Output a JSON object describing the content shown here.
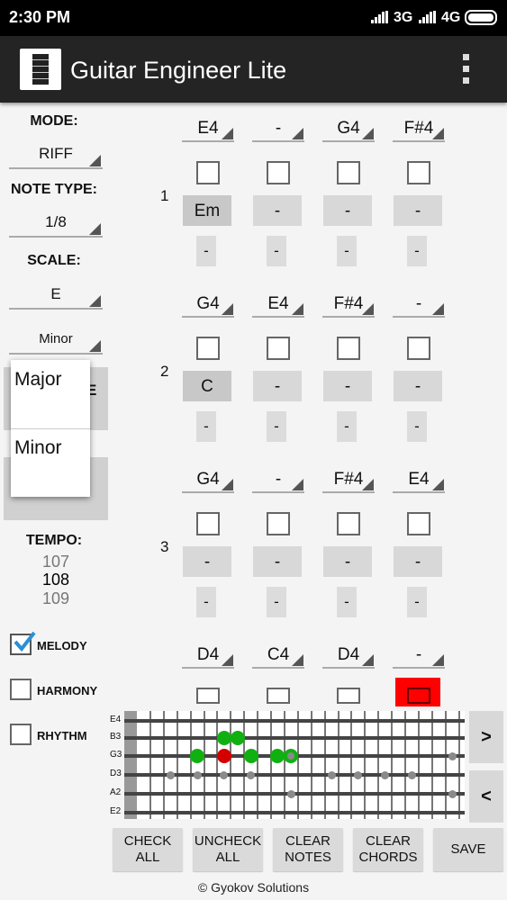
{
  "status": {
    "time": "2:30 PM",
    "net1": "3G",
    "net2": "4G"
  },
  "app": {
    "title": "Guitar Engineer Lite",
    "icons": {
      "app": "guitar-neck-icon",
      "menu": "overflow-menu-icon"
    }
  },
  "sidebar": {
    "mode_label": "MODE:",
    "mode_value": "RIFF",
    "note_type_label": "NOTE TYPE:",
    "note_type_value": "1/8",
    "scale_label": "SCALE:",
    "scale_root": "E",
    "scale_type": "Minor",
    "scale_type_options": [
      "Major",
      "Minor"
    ],
    "hidden_fragment": "E",
    "tempo_label": "TEMPO:",
    "tempo_prev": "107",
    "tempo_value": "108",
    "tempo_next": "109",
    "tracks": [
      {
        "label": "MELODY",
        "checked": true
      },
      {
        "label": "HARMONY",
        "checked": false
      },
      {
        "label": "RHYTHM",
        "checked": false
      }
    ]
  },
  "bars": [
    {
      "number": "1",
      "notes": [
        "E4",
        "-",
        "G4",
        "F#4"
      ],
      "chords": [
        "Em",
        "-",
        "-",
        "-"
      ],
      "subs": [
        "-",
        "-",
        "-",
        "-"
      ]
    },
    {
      "number": "2",
      "notes": [
        "G4",
        "E4",
        "F#4",
        "-"
      ],
      "chords": [
        "C",
        "-",
        "-",
        "-"
      ],
      "subs": [
        "-",
        "-",
        "-",
        "-"
      ]
    },
    {
      "number": "3",
      "notes": [
        "G4",
        "-",
        "F#4",
        "E4"
      ],
      "chords": [
        "-",
        "-",
        "-",
        "-"
      ],
      "subs": [
        "-",
        "-",
        "-",
        "-"
      ]
    },
    {
      "number": "",
      "notes": [
        "D4",
        "C4",
        "D4",
        "-"
      ],
      "chords": [],
      "subs": []
    }
  ],
  "fretboard": {
    "strings": [
      "E4",
      "B3",
      "G3",
      "D3",
      "A2",
      "E2"
    ],
    "frets": 24,
    "markers": [
      {
        "string": 1,
        "fret": 7,
        "color": "green"
      },
      {
        "string": 1,
        "fret": 8,
        "color": "green"
      },
      {
        "string": 2,
        "fret": 5,
        "color": "green"
      },
      {
        "string": 2,
        "fret": 7,
        "color": "red"
      },
      {
        "string": 2,
        "fret": 9,
        "color": "green"
      },
      {
        "string": 2,
        "fret": 11,
        "color": "green"
      },
      {
        "string": 2,
        "fret": 12,
        "color": "green"
      },
      {
        "string": 3,
        "fret": 3,
        "color": "grey"
      },
      {
        "string": 3,
        "fret": 5,
        "color": "grey"
      },
      {
        "string": 3,
        "fret": 7,
        "color": "grey"
      },
      {
        "string": 3,
        "fret": 9,
        "color": "grey"
      },
      {
        "string": 3,
        "fret": 15,
        "color": "grey"
      },
      {
        "string": 3,
        "fret": 17,
        "color": "grey"
      },
      {
        "string": 3,
        "fret": 19,
        "color": "grey"
      },
      {
        "string": 3,
        "fret": 21,
        "color": "grey"
      },
      {
        "string": 2,
        "fret": 12,
        "color": "grey-small"
      },
      {
        "string": 4,
        "fret": 12,
        "color": "grey"
      },
      {
        "string": 2,
        "fret": 24,
        "color": "grey"
      },
      {
        "string": 4,
        "fret": 24,
        "color": "grey"
      }
    ],
    "colors": {
      "green": "#11b011",
      "red": "#d40000",
      "grey": "#8a8a8a"
    },
    "next_label": ">",
    "prev_label": "<"
  },
  "buttons": {
    "check_all": "CHECK ALL",
    "uncheck_all": "UNCHECK ALL",
    "clear_notes": "CLEAR NOTES",
    "clear_chords": "CLEAR CHORDS",
    "save": "SAVE"
  },
  "footer": "© Gyokov Solutions",
  "colors": {
    "appbar": "#242424",
    "highlight": "#ff0000",
    "check_accent": "#2a8fd8"
  }
}
